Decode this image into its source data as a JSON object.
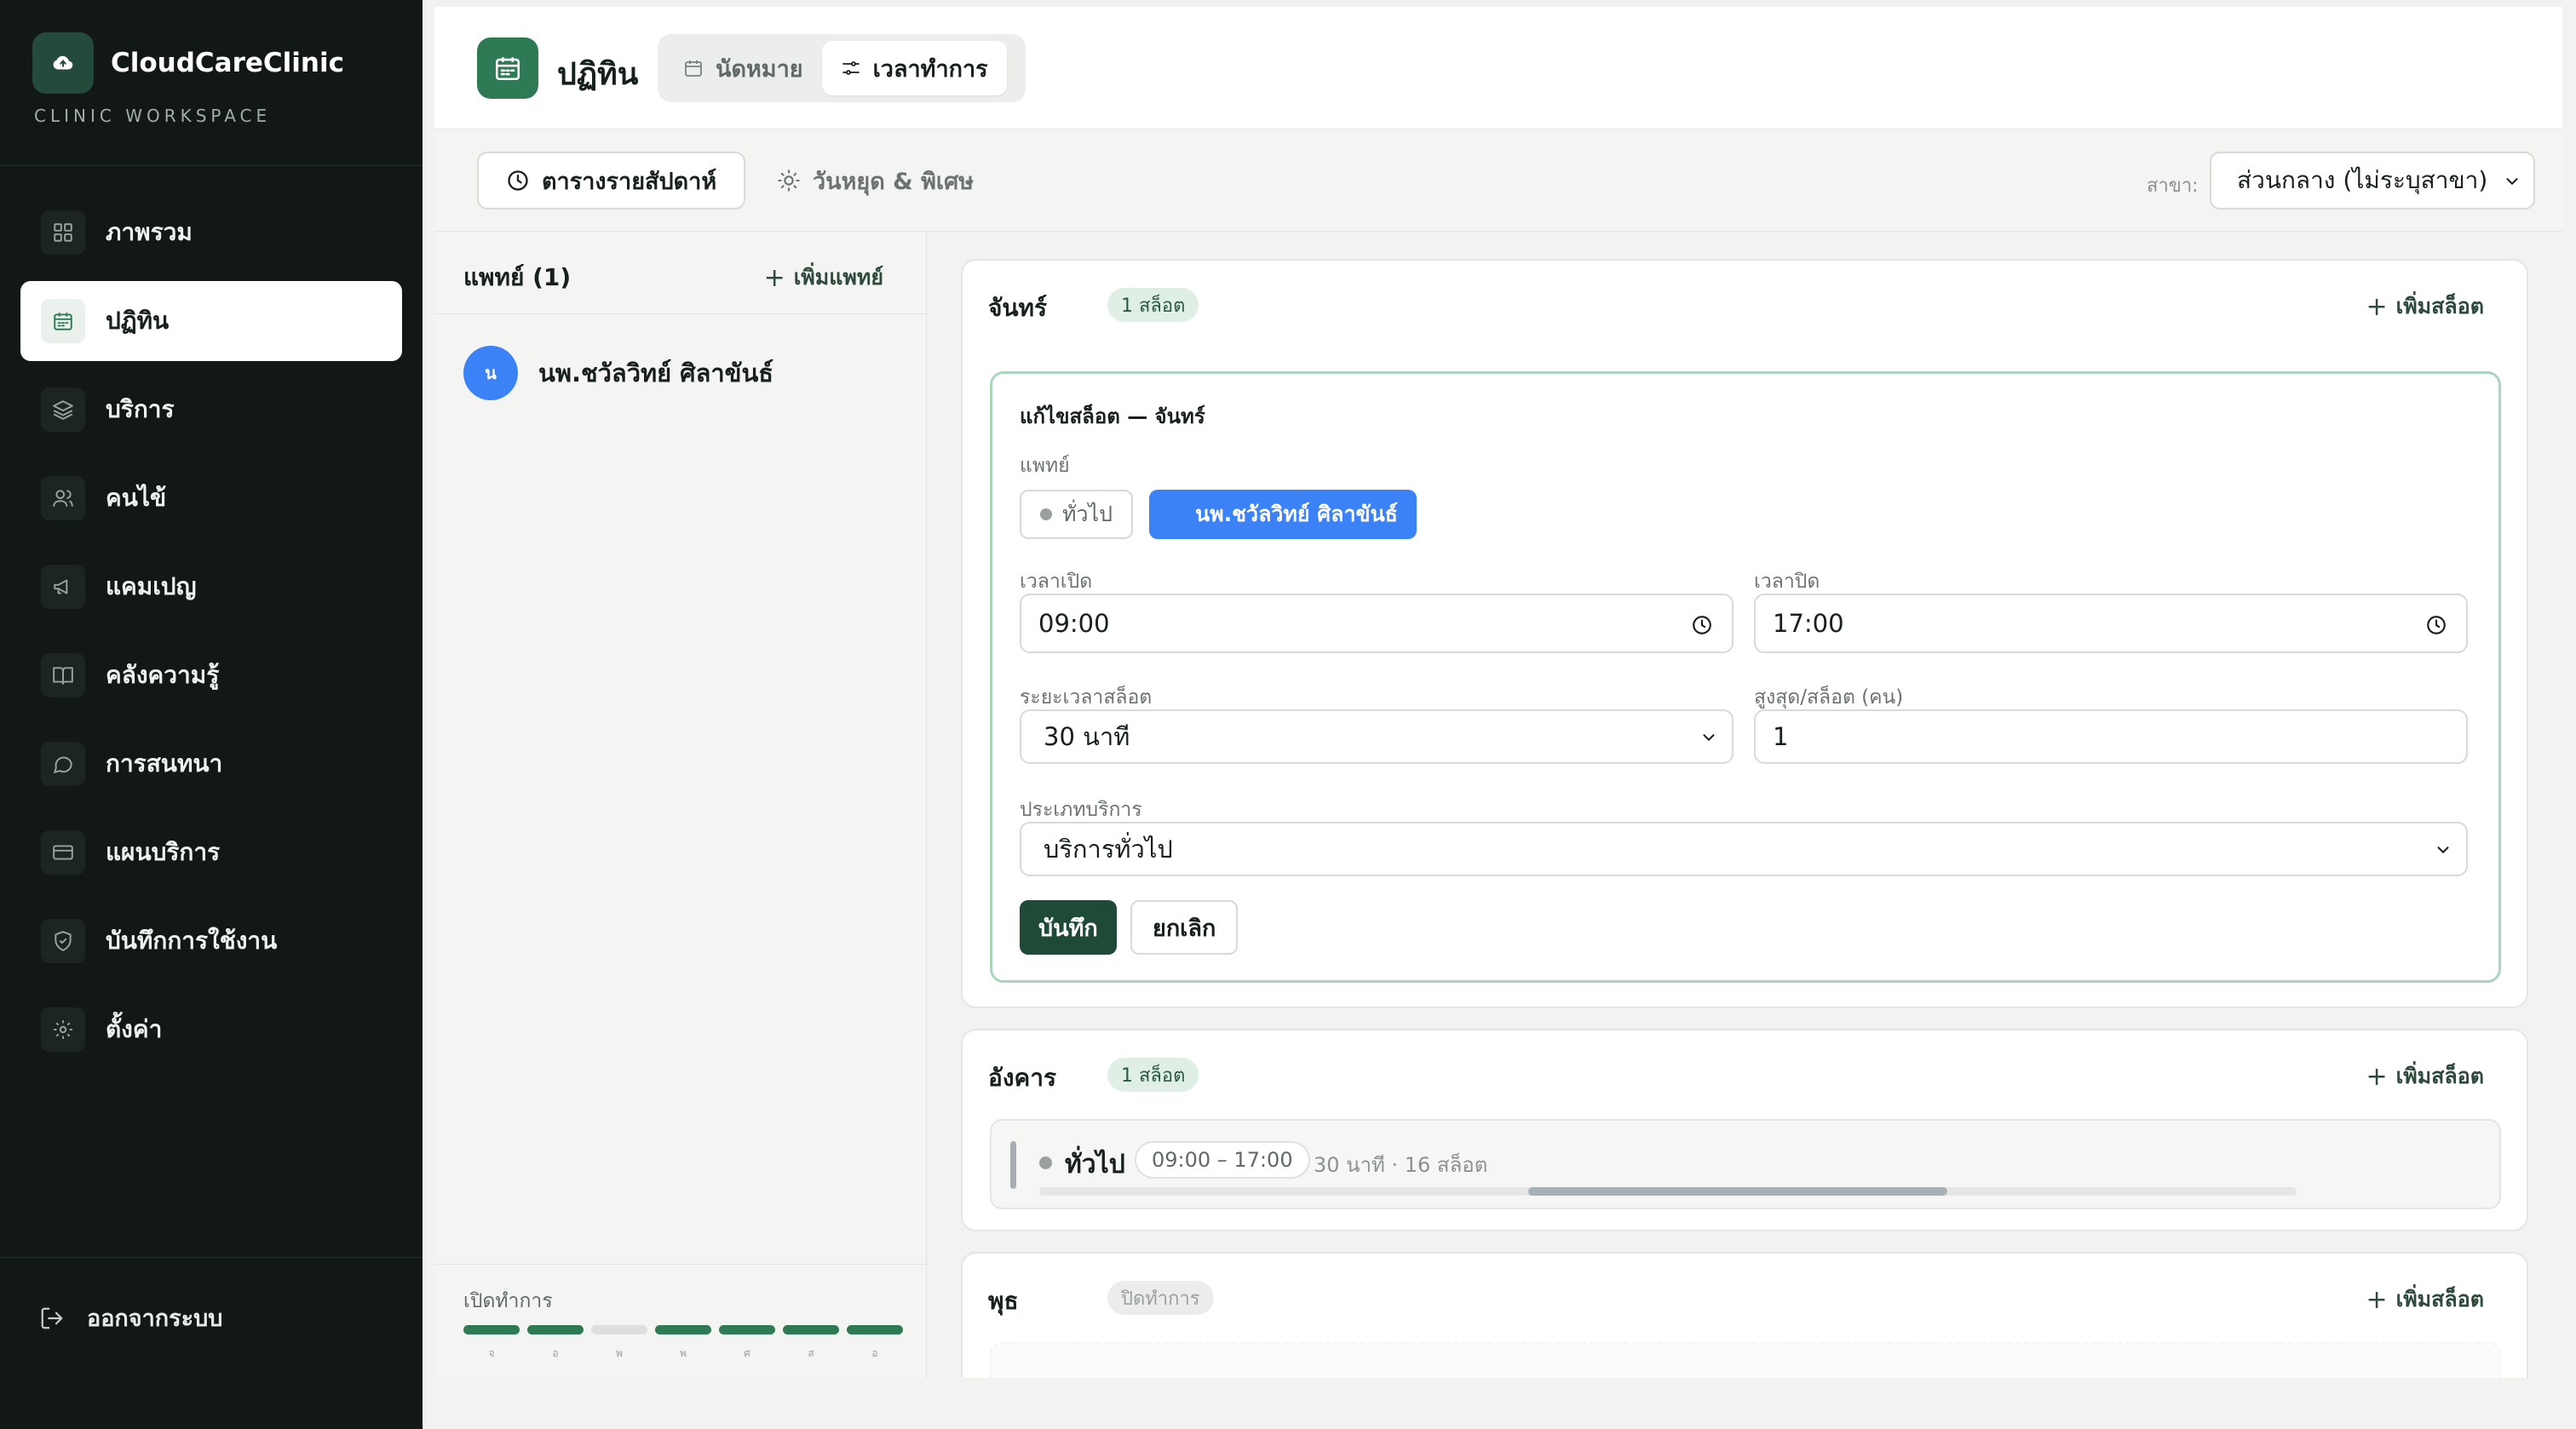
{
  "brand": {
    "name": "CloudCareClinic",
    "subtitle": "CLINIC WORKSPACE"
  },
  "sidebar": {
    "items": [
      {
        "label": "ภาพรวม",
        "icon": "grid-icon"
      },
      {
        "label": "ปฏิทิน",
        "icon": "calendar-icon",
        "active": true
      },
      {
        "label": "บริการ",
        "icon": "layers-icon"
      },
      {
        "label": "คนไข้",
        "icon": "users-icon"
      },
      {
        "label": "แคมเปญ",
        "icon": "megaphone-icon"
      },
      {
        "label": "คลังความรู้",
        "icon": "book-icon"
      },
      {
        "label": "การสนทนา",
        "icon": "chat-icon"
      },
      {
        "label": "แผนบริการ",
        "icon": "card-icon"
      },
      {
        "label": "บันทึกการใช้งาน",
        "icon": "shield-icon"
      },
      {
        "label": "ตั้งค่า",
        "icon": "gear-icon"
      }
    ],
    "logout": "ออกจากระบบ"
  },
  "header": {
    "title": "ปฏิทิน",
    "tabs": [
      {
        "label": "นัดหมาย",
        "active": false
      },
      {
        "label": "เวลาทำการ",
        "active": true
      }
    ]
  },
  "toolbar": {
    "weekly": "ตารางรายสัปดาห์",
    "holidays": "วันหยุด & พิเศษ",
    "branch_label": "สาขา:",
    "branch_value": "ส่วนกลาง (ไม่ระบุสาขา)"
  },
  "doctors": {
    "heading": "แพทย์ (1)",
    "add": "เพิ่มแพทย์",
    "list": [
      {
        "initial": "น",
        "name": "นพ.ชวัลวิทย์ ศิลาขันธ์"
      }
    ],
    "open_label": "เปิดทำการ",
    "week_open": [
      true,
      true,
      false,
      true,
      true,
      true,
      true
    ],
    "week_letters": [
      "จ",
      "อ",
      "พ",
      "พ",
      "ศ",
      "ส",
      "อ"
    ]
  },
  "schedule": {
    "add_slot": "เพิ่มสล็อต",
    "monday": {
      "day": "จันทร์",
      "badge": "1 สล็อต",
      "form": {
        "title": "แก้ไขสล็อต — จันทร์",
        "doctor_label": "แพทย์",
        "chip_general": "ทั่วไป",
        "chip_doctor": "นพ.ชวัลวิทย์ ศิลาขันธ์",
        "open_label": "เวลาเปิด",
        "open_value": "09:00",
        "close_label": "เวลาปิด",
        "close_value": "17:00",
        "duration_label": "ระยะเวลาสล็อต",
        "duration_value": "30 นาที",
        "max_label": "สูงสุด/สล็อต (คน)",
        "max_value": "1",
        "service_label": "ประเภทบริการ",
        "service_value": "บริการทั่วไป",
        "save": "บันทึก",
        "cancel": "ยกเลิก"
      }
    },
    "tuesday": {
      "day": "อังคาร",
      "badge": "1 สล็อต",
      "slot": {
        "name": "ทั่วไป",
        "time": "09:00 – 17:00",
        "meta": "30 นาที · 16 สล็อต"
      }
    },
    "wednesday": {
      "day": "พุธ",
      "badge": "ปิดทำการ"
    }
  },
  "colors": {
    "accent": "#2e7a55",
    "sidebar_bg": "#121816",
    "doctor_blue": "#3b82f6",
    "save_btn": "#1f4a37"
  }
}
